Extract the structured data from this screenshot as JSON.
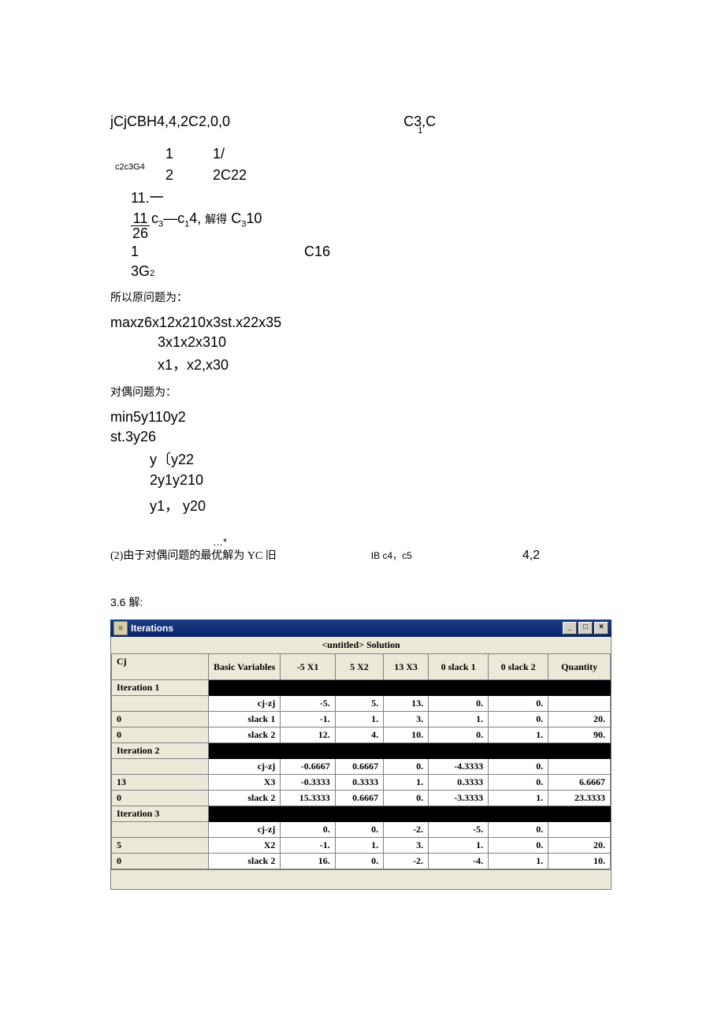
{
  "block1": {
    "l1a": "jCjCBH4,4,2C2,0,0",
    "l1b": "C3,C",
    "l1c": "1",
    "l2a": "1",
    "l2b": "1/",
    "l2pre": "c2c3G4",
    "l3a": "2",
    "l3b": "2C22",
    "l4a": "11.一",
    "frac_top": "11",
    "frac_bot": "26",
    "l5a": "c3—c14, 解得 C310",
    "l6a": "1",
    "l6b": "C16",
    "l7a": "3G",
    "l7sup": "2"
  },
  "chinese": {
    "c1": "所以原问题为：",
    "c2": "对偶问题为：",
    "c3": "(2)由于对偶问题的最优解为 YC 旧",
    "c3_mid": "IB c4，c5",
    "c3_right": "4,2",
    "c3_dots": "…*",
    "c4": "3.6 解:"
  },
  "primal": {
    "p1": "maxz6x12x210x3st.x22x35",
    "p2": "3x1x2x310",
    "p3": "x1，x2,x30"
  },
  "dual": {
    "d1": "min5y110y2",
    "d2": "st.3y26",
    "d3": "y〔y22",
    "d4": "2y1y210",
    "d5": "y1， y20"
  },
  "win": {
    "title": "Iterations",
    "subtitle": "<untitled> Solution",
    "headers": [
      "Cj",
      "Basic Variables",
      "-5 X1",
      "5 X2",
      "13 X3",
      "0 slack 1",
      "0 slack 2",
      "Quantity"
    ],
    "iter1": "Iteration 1",
    "iter2": "Iteration 2",
    "iter3": "Iteration 3",
    "rows1": [
      [
        "",
        "cj-zj",
        "-5.",
        "5.",
        "13.",
        "0.",
        "0.",
        ""
      ],
      [
        "0",
        "slack 1",
        "-1.",
        "1.",
        "3.",
        "1.",
        "0.",
        "20."
      ],
      [
        "0",
        "slack 2",
        "12.",
        "4.",
        "10.",
        "0.",
        "1.",
        "90."
      ]
    ],
    "rows2": [
      [
        "",
        "cj-zj",
        "-0.6667",
        "0.6667",
        "0.",
        "-4.3333",
        "0.",
        ""
      ],
      [
        "13",
        "X3",
        "-0.3333",
        "0.3333",
        "1.",
        "0.3333",
        "0.",
        "6.6667"
      ],
      [
        "0",
        "slack 2",
        "15.3333",
        "0.6667",
        "0.",
        "-3.3333",
        "1.",
        "23.3333"
      ]
    ],
    "rows3": [
      [
        "",
        "cj-zj",
        "0.",
        "0.",
        "-2.",
        "-5.",
        "0.",
        ""
      ],
      [
        "5",
        "X2",
        "-1.",
        "1.",
        "3.",
        "1.",
        "0.",
        "20."
      ],
      [
        "0",
        "slack 2",
        "16.",
        "0.",
        "-2.",
        "-4.",
        "1.",
        "10."
      ]
    ]
  }
}
